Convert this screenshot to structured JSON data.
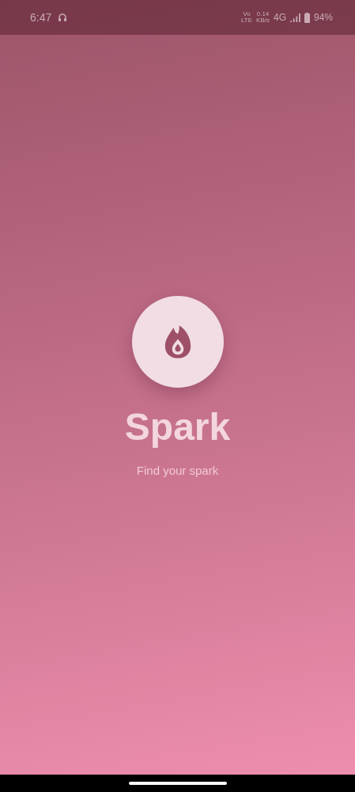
{
  "status_bar": {
    "time": "6:47",
    "volte_top": "Vo",
    "volte_bottom": "LTE",
    "speed_value": "0.14",
    "speed_unit": "KB/s",
    "network": "4G",
    "battery": "94%"
  },
  "splash": {
    "title": "Spark",
    "tagline": "Find your spark"
  }
}
